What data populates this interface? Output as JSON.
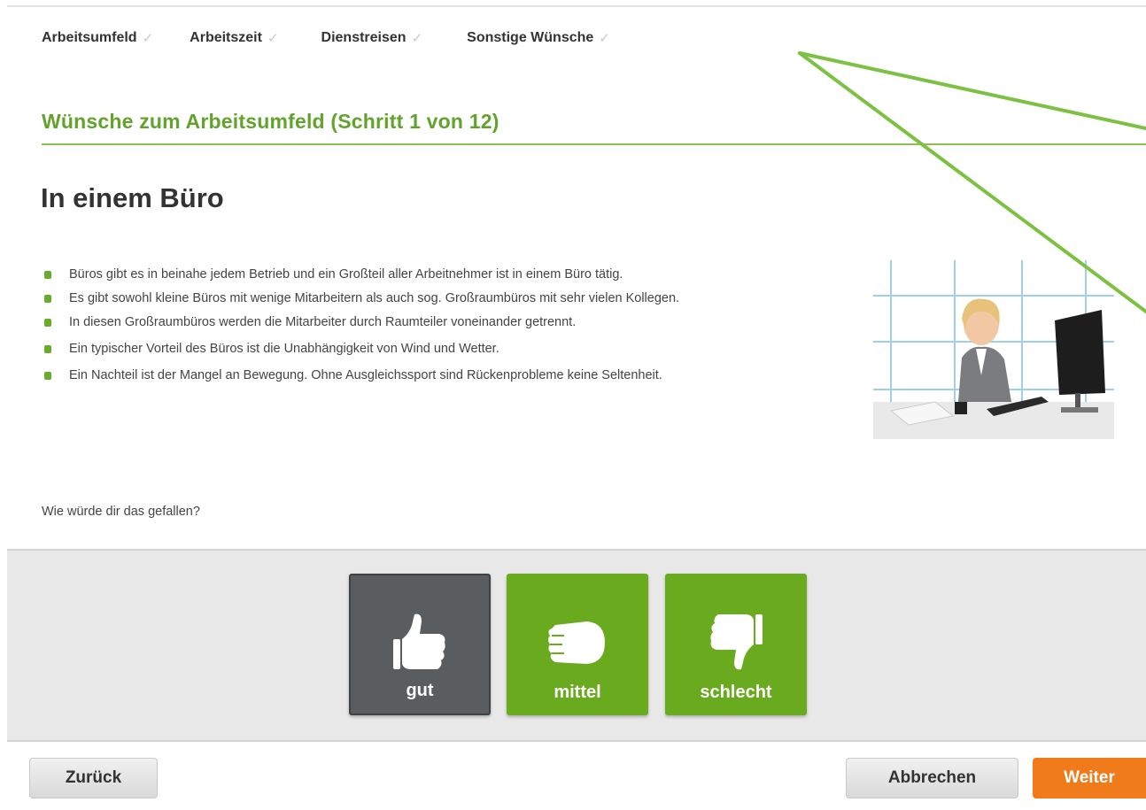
{
  "steps": [
    {
      "label": "Arbeitsumfeld",
      "check": "✓"
    },
    {
      "label": "Arbeitszeit",
      "check": "✓"
    },
    {
      "label": "Dienstreisen",
      "check": "✓"
    },
    {
      "label": "Sonstige Wünsche",
      "check": "✓"
    }
  ],
  "section": {
    "title": "Wünsche zum Arbeitsumfeld (Schritt 1 von 12)"
  },
  "headline": "In einem Büro",
  "bullets": [
    "Büros gibt es in beinahe jedem Betrieb und ein Großteil aller Arbeitnehmer ist in einem Büro tätig.",
    "Es gibt sowohl kleine Büros mit wenige Mitarbeitern als auch sog. Großraumbüros mit sehr vielen Kollegen.",
    "In diesen Großraumbüros werden die Mitarbeiter durch Raumteiler voneinander getrennt.",
    "Ein typischer Vorteil des Büros ist die Unabhängigkeit von Wind und Wetter.",
    "Ein Nachteil ist der Mangel an Bewegung. Ohne Ausgleichssport sind Rückenprobleme keine Seltenheit."
  ],
  "question": "Wie würde dir das gefallen?",
  "rating": {
    "gut": "gut",
    "mittel": "mittel",
    "schlecht": "schlecht"
  },
  "footer": {
    "back": "Zurück",
    "cancel": "Abbrechen",
    "next": "Weiter"
  },
  "colors": {
    "accent_green": "#62a32c",
    "button_green": "#6aaa1f",
    "selected_gray": "#5a5d5f",
    "next_orange": "#f07b1a",
    "annotation_line": "#7cc142"
  },
  "icons": {
    "photo": "office-woman-photo",
    "gut": "thumbs-up-icon",
    "mittel": "fist-icon",
    "schlecht": "thumbs-down-icon"
  }
}
